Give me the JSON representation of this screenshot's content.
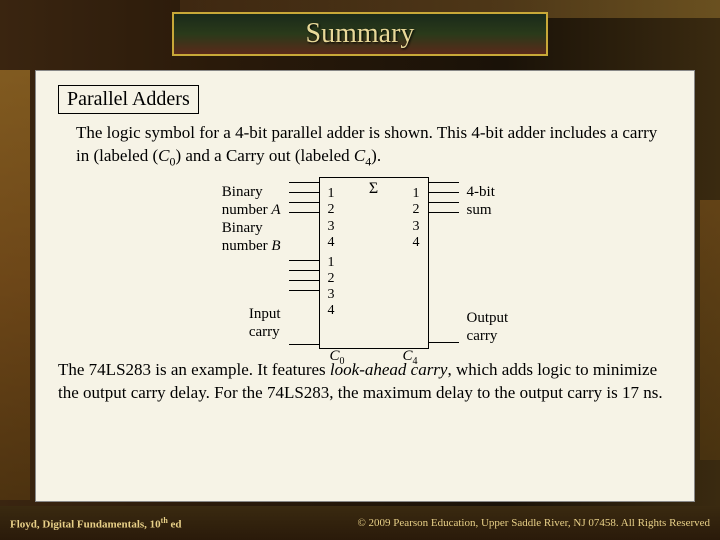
{
  "title": "Summary",
  "subheading": "Parallel Adders",
  "para1_a": "The logic symbol for a 4-bit parallel adder is shown. This 4-bit adder includes a carry in (labeled (",
  "para1_c0_c": "C",
  "para1_c0_s": "0",
  "para1_b": ") and a Carry out (labeled ",
  "para1_c4_c": "C",
  "para1_c4_s": "4",
  "para1_c": ").",
  "diagram": {
    "labelA_1": "Binary",
    "labelA_2": "number ",
    "labelA_i": "A",
    "labelB_1": "Binary",
    "labelB_2": "number ",
    "labelB_i": "B",
    "labelCin_1": "Input",
    "labelCin_2": "carry",
    "sigma": "Σ",
    "pins_left_a": [
      "1",
      "2",
      "3",
      "4"
    ],
    "pins_left_b": [
      "1",
      "2",
      "3",
      "4"
    ],
    "pins_right": [
      "1",
      "2",
      "3",
      "4"
    ],
    "c0_c": "C",
    "c0_s": "0",
    "c4_c": "C",
    "c4_s": "4",
    "labelSum_1": "4-bit",
    "labelSum_2": "sum",
    "labelCout_1": "Output",
    "labelCout_2": "carry"
  },
  "para2_a": "The 74LS283 is an example. It features ",
  "para2_i": "look-ahead carry",
  "para2_b": ", which adds logic to minimize the output carry delay. For the 74LS283, the maximum delay to the output carry is 17 ns.",
  "footer_left_a": "Floyd, Digital Fundamentals, 10",
  "footer_left_b": "th",
  "footer_left_c": " ed",
  "footer_right": "© 2009 Pearson Education, Upper Saddle River, NJ 07458. All Rights Reserved"
}
